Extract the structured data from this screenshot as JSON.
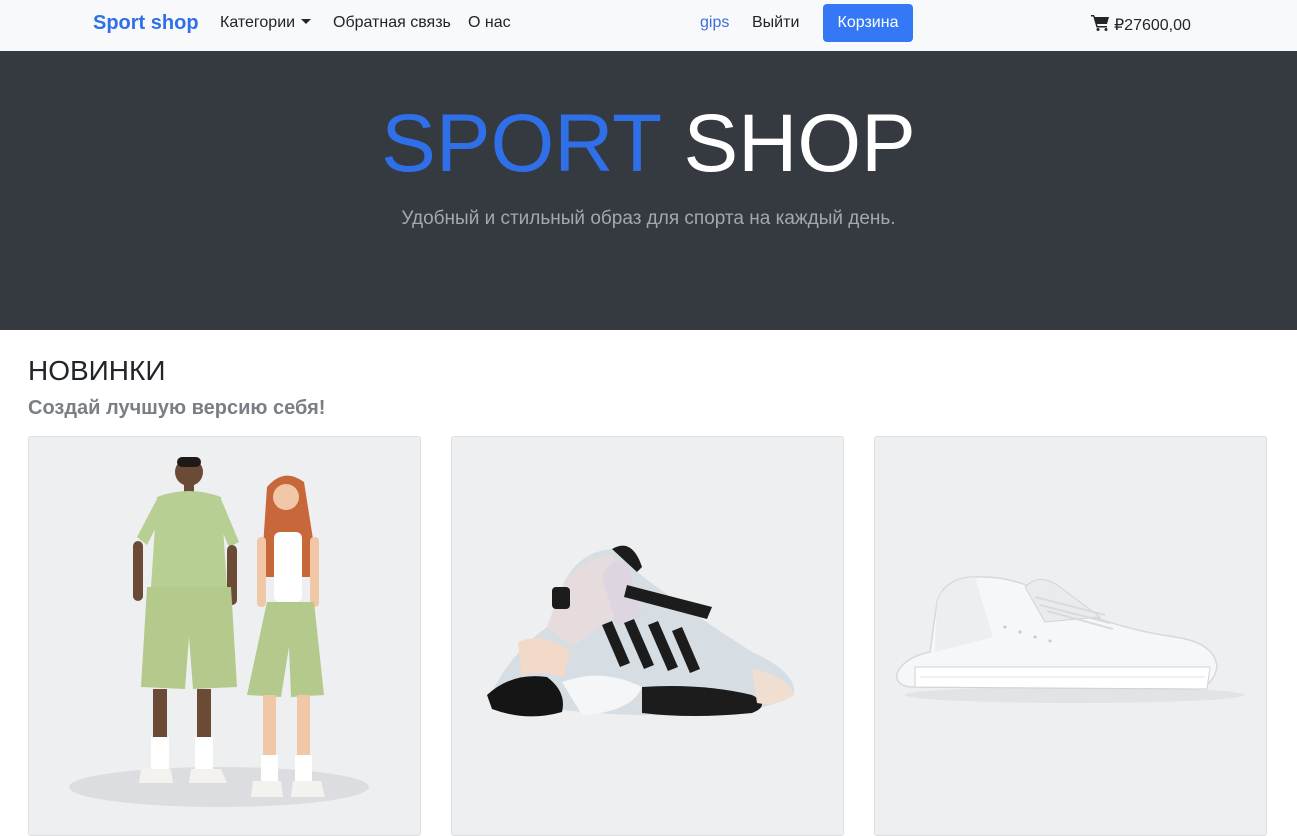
{
  "navbar": {
    "brand": "Sport shop",
    "categories_label": "Категории",
    "feedback_label": "Обратная связь",
    "about_label": "О нас",
    "username": "gips",
    "logout_label": "Выйти",
    "cart_button_label": "Корзина",
    "cart_total": "₽27600,00"
  },
  "hero": {
    "title_part1": "SPORT",
    "title_part2": "SHOP",
    "subtitle": "Удобный и стильный образ для спорта на каждый день."
  },
  "section": {
    "title": "НОВИНКИ",
    "subtitle": "Создай лучшую версию себя!"
  },
  "colors": {
    "accent": "#2f6fe8",
    "button": "#3478f6",
    "hero_bg": "#343a40",
    "navbar_bg": "#f8f9fa"
  },
  "products": [
    {
      "image": "green-outfit-models-photo"
    },
    {
      "image": "streetball-sneaker-photo"
    },
    {
      "image": "white-leather-sneaker-photo"
    }
  ]
}
